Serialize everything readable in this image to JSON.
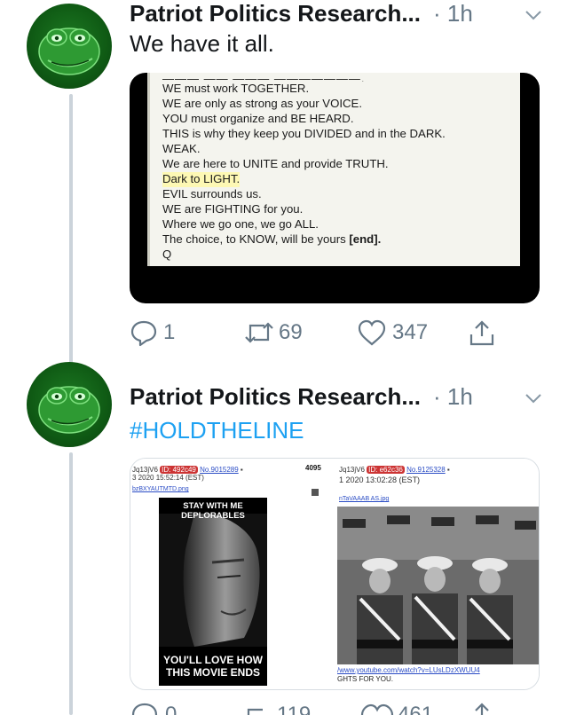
{
  "tweets": [
    {
      "author": "Patriot Politics Research...",
      "time": "· 1h",
      "text": "We have it all.",
      "media": {
        "lines": [
          "WE must work TOGETHER.",
          "WE are only as strong as your VOICE.",
          "YOU must organize and BE HEARD.",
          "THIS is why they keep you DIVIDED and in the DARK.",
          "WEAK.",
          "We are here to UNITE and provide TRUTH.",
          "Dark to LIGHT.",
          "EVIL surrounds us.",
          "WE are FIGHTING for you.",
          "Where we go one, we go ALL.",
          "The choice, to KNOW, will be yours",
          "Q"
        ],
        "end_tag": "[end]."
      },
      "actions": {
        "replies": "1",
        "retweets": "69",
        "likes": "347"
      }
    },
    {
      "author": "Patriot Politics Research...",
      "time": "· 1h",
      "text": "#HOLDTHELINE",
      "media": {
        "left": {
          "header_user": "Jq13jV6",
          "header_id": "ID: 492c49",
          "header_no": "No.9015289",
          "header_date": "3 2020 15:52:14 (EST)",
          "filename": "bzBXYAUTMTD.png",
          "count": "4095",
          "poster_top": "STAY WITH ME DEPLORABLES",
          "poster_bottom_1": "YOU'LL LOVE HOW",
          "poster_bottom_2": "THIS MOVIE ENDS"
        },
        "right": {
          "header_user": "Jq13jV6",
          "header_id": "ID: e62c36",
          "header_no": "No.9125328",
          "header_date": "1 2020 13:02:28 (EST)",
          "filename": "nTaVAAAB AS.jpg",
          "link": "/www.youtube.com/watch?v=LUsLDzXWUU4",
          "caption": "GHTS FOR YOU."
        }
      },
      "actions": {
        "replies": "0",
        "retweets": "119",
        "likes": "461"
      }
    }
  ],
  "colors": {
    "accent": "#1da1f2",
    "meta_grey": "#657786",
    "thread_line": "#cbd3da"
  },
  "icons": [
    "reply-icon",
    "retweet-icon",
    "like-icon",
    "share-icon",
    "chevron-down-icon"
  ]
}
